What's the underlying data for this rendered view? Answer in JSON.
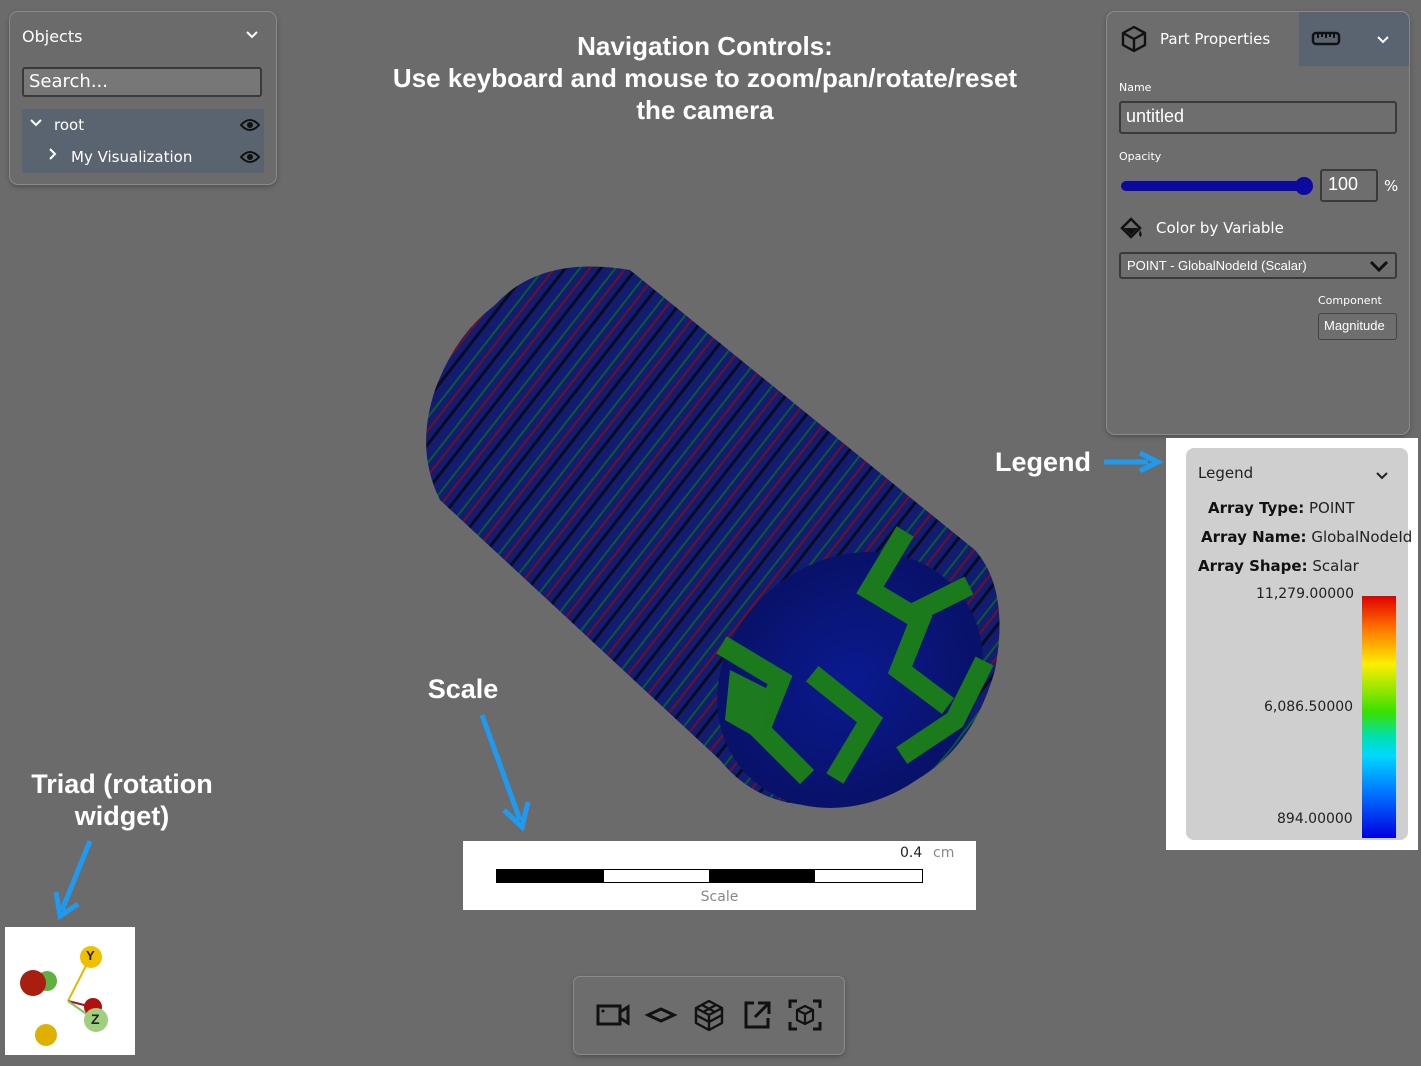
{
  "objects_panel": {
    "title": "Objects",
    "search_placeholder": "Search...",
    "tree": [
      {
        "label": "root"
      },
      {
        "label": "My Visualization"
      }
    ]
  },
  "annotations": {
    "nav_title_line1": "Navigation Controls:",
    "nav_title_line2": "Use keyboard and mouse to zoom/pan/rotate/reset",
    "nav_title_line3": "the camera",
    "legend_callout": "Legend",
    "scale_callout": "Scale",
    "triad_callout_line1": "Triad (rotation",
    "triad_callout_line2": "widget)"
  },
  "part_properties": {
    "title": "Part Properties",
    "name_label": "Name",
    "name_value": "untitled",
    "opacity_label": "Opacity",
    "opacity_value": "100",
    "opacity_unit": "%",
    "opacity_fraction": 1.0,
    "color_by_label": "Color by Variable",
    "color_by_value": "POINT - GlobalNodeId (Scalar)",
    "component_label": "Component",
    "component_value": "Magnitude"
  },
  "legend": {
    "title": "Legend",
    "array_type_label": "Array Type:",
    "array_type_value": "POINT",
    "array_name_label": "Array Name:",
    "array_name_value": "GlobalNodeId",
    "array_shape_label": "Array Shape:",
    "array_shape_value": "Scalar",
    "max_value": "11,279.00000",
    "mid_value": "6,086.50000",
    "min_value": "894.00000"
  },
  "scale_bar": {
    "value": "0.4",
    "unit": "cm",
    "label": "Scale"
  },
  "triad": {
    "y_label": "Y",
    "z_label": "Z"
  },
  "colors": {
    "background": "#6b6b6b",
    "accent_blue": "#1e9bf0",
    "slider_blue": "#0a0aa0"
  }
}
